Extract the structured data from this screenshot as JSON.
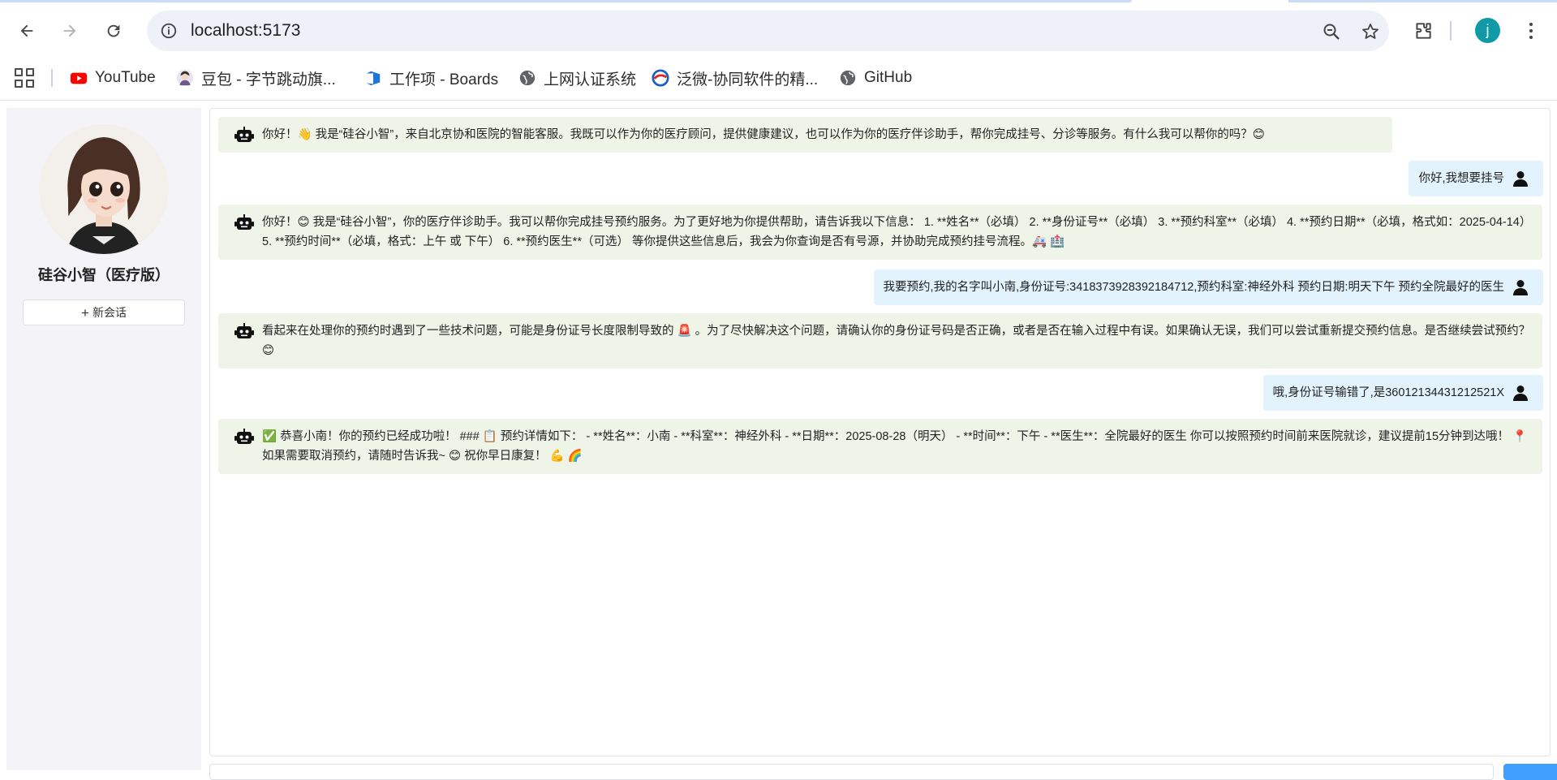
{
  "browser": {
    "url": "localhost:5173",
    "bookmarks": [
      {
        "label": "YouTube",
        "icon": "youtube-icon"
      },
      {
        "label": "豆包 - 字节跳动旗...",
        "icon": "doubao-icon"
      },
      {
        "label": "工作项 - Boards",
        "icon": "azure-boards-icon"
      },
      {
        "label": "上网认证系统",
        "icon": "globe-icon"
      },
      {
        "label": "泛微-协同软件的精...",
        "icon": "weaver-icon"
      },
      {
        "label": "GitHub",
        "icon": "globe-icon"
      }
    ],
    "profile_initial": "j",
    "profile_color": "#0f9aa5"
  },
  "sidebar": {
    "title": "硅谷小智（医疗版）",
    "new_chat_icon": "+",
    "new_chat_label": "新会话"
  },
  "messages": [
    {
      "role": "bot",
      "text": "你好！👋 我是“硅谷小智”，来自北京协和医院的智能客服。我既可以作为你的医疗顾问，提供健康建议，也可以作为你的医疗伴诊助手，帮你完成挂号、分诊等服务。有什么我可以帮你的吗？😊"
    },
    {
      "role": "user",
      "text": "你好,我想要挂号"
    },
    {
      "role": "bot",
      "text": "你好！😊 我是“硅谷小智”，你的医疗伴诊助手。我可以帮你完成挂号预约服务。为了更好地为你提供帮助，请告诉我以下信息： 1. **姓名**（必填） 2. **身份证号**（必填） 3. **预约科室**（必填） 4. **预约日期**（必填，格式如：2025-04-14） 5. **预约时间**（必填，格式：上午 或 下午） 6. **预约医生**（可选） 等你提供这些信息后，我会为你查询是否有号源，并协助完成预约挂号流程。🚑 🏥"
    },
    {
      "role": "user",
      "text": "我要预约,我的名字叫小南,身份证号:341837392839218471​2,预约科室:神经外科 预约日期:明天下午 预约全院最好的医生"
    },
    {
      "role": "bot",
      "text": "看起来在处理你的预约时遇到了一些技术问题，可能是身份证号长度限制导致的 🚨 。为了尽快解决这个问题，请确认你的身份证号码是否正确，或者是否在输入过程中有误。如果确认无误，我们可以尝试重新提交预约信息。是否继续尝试预约？😊"
    },
    {
      "role": "user",
      "text": "哦,身份证号输错了,是36012134431212521X"
    },
    {
      "role": "bot",
      "text": "✅ 恭喜小南！你的预约已经成功啦！ ### 📋 预约详情如下： - **姓名**：小南 - **科室**：神经外科 - **日期**：2025-08-28（明天） - **时间**：下午 - **医生**：全院最好的医生 你可以按照预约时间前来医院就诊，建议提前15分钟到达哦！ 📍 如果需要取消预约，请随时告诉我~ 😊 祝你早日康复！ 💪 🌈"
    }
  ],
  "colors": {
    "bot_bubble": "#eef5e8",
    "user_bubble": "#e3f3fd",
    "send_button": "#409eff"
  }
}
